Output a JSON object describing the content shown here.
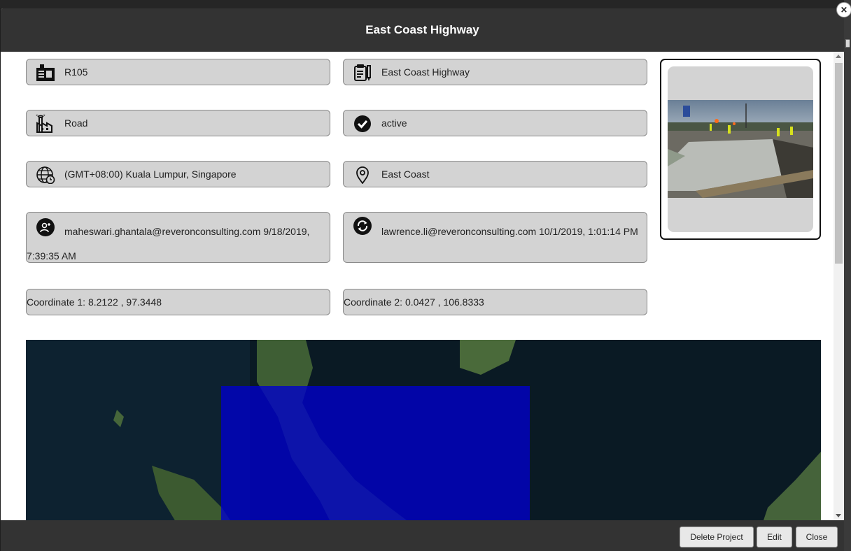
{
  "dialog": {
    "title": "East Coast Highway",
    "close_glyph": "×"
  },
  "fields": {
    "code": {
      "icon": "id-card-icon",
      "value": "R105"
    },
    "name": {
      "icon": "document-pen-icon",
      "value": "East Coast Highway"
    },
    "type": {
      "icon": "factory-signal-icon",
      "value": "Road"
    },
    "status": {
      "icon": "check-circle-icon",
      "value": "active"
    },
    "timezone": {
      "icon": "globe-clock-icon",
      "value": "(GMT+08:00) Kuala Lumpur, Singapore"
    },
    "location": {
      "icon": "map-pin-icon",
      "value": "East Coast"
    },
    "created": {
      "icon": "user-add-icon",
      "value": "maheswari.ghantala@reveronconsulting.com 9/18/2019, 7:39:35 AM"
    },
    "updated": {
      "icon": "refresh-circle-icon",
      "value": "lawrence.li@reveronconsulting.com 10/1/2019, 1:01:14 PM"
    },
    "coordinate1": {
      "value": "Coordinate 1: 8.2122 , 97.3448"
    },
    "coordinate2": {
      "value": "Coordinate 2: 0.0427 , 106.8333"
    }
  },
  "image": {
    "description_icon": "project-photo-icon"
  },
  "map": {
    "overlay_color": "#0000cc",
    "water_color": "#0a1a24",
    "land_color": "#3a5a2c"
  },
  "footer": {
    "delete_label": "Delete Project",
    "edit_label": "Edit",
    "close_label": "Close"
  },
  "colors": {
    "header_bg": "#333333",
    "field_bg": "#d3d3d3",
    "footer_bg": "#333333"
  }
}
